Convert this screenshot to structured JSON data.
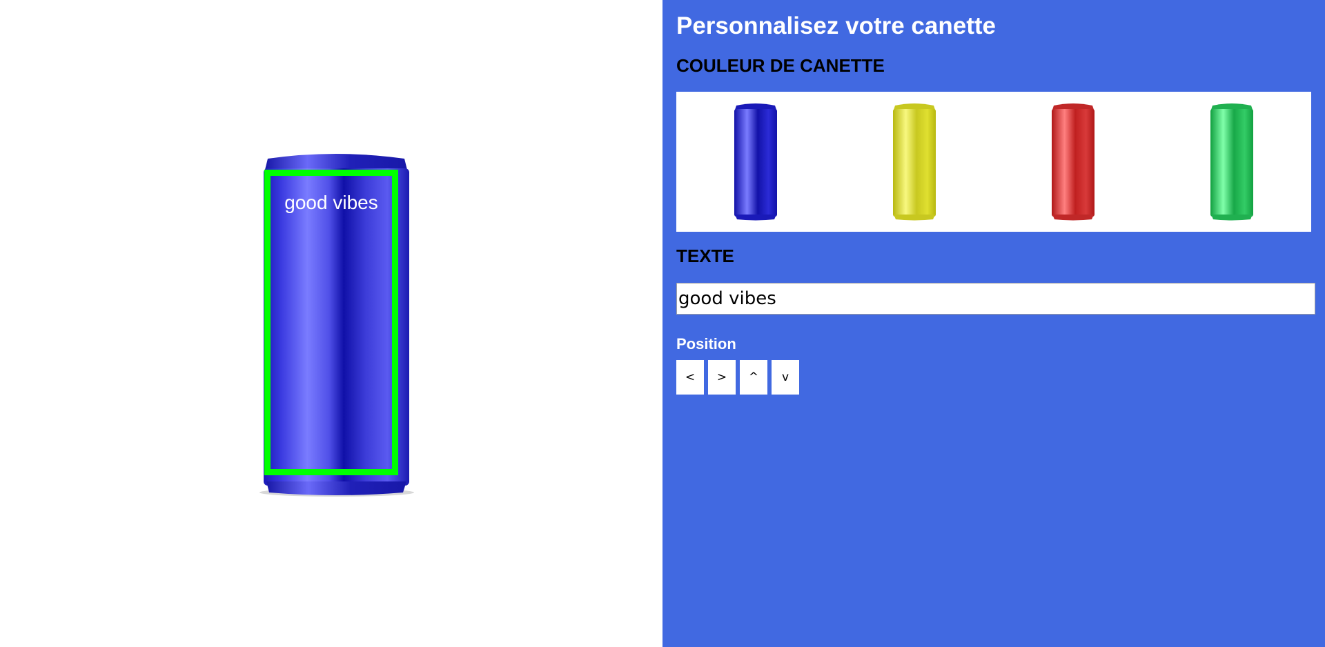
{
  "preview": {
    "can_color": "#2a2ad8",
    "can_text": "good vibes",
    "print_area_color": "#00ff00"
  },
  "panel": {
    "title": "Personnalisez votre canette",
    "color_section_label": "COULEUR DE CANETTE",
    "can_colors": [
      {
        "name": "blue",
        "base": "#2b2bd6",
        "light": "#7a7cff",
        "dark": "#1212a8"
      },
      {
        "name": "yellow",
        "base": "#e0e030",
        "light": "#f8f880",
        "dark": "#b8b810"
      },
      {
        "name": "red",
        "base": "#d83a3a",
        "light": "#ff8080",
        "dark": "#b01818"
      },
      {
        "name": "green",
        "base": "#33cc66",
        "light": "#80ffaa",
        "dark": "#12a040"
      }
    ],
    "text_section_label": "TEXTE",
    "text_input_value": "good vibes",
    "position_label": "Position",
    "position_buttons": [
      "<",
      ">",
      "^",
      "v"
    ],
    "background_color": "#4169e1"
  }
}
